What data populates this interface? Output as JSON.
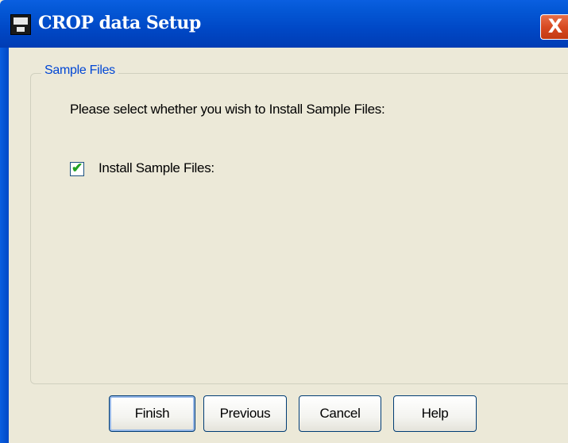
{
  "window": {
    "title": "CROP data Setup",
    "title_icon": "floppy-disk-icon",
    "close_glyph": "X",
    "colors": {
      "titlebar": "#0048c6",
      "close": "#d84a22",
      "body": "#ece9d8",
      "group_label": "#0046d5",
      "checkmark": "#21a121"
    }
  },
  "group": {
    "label": "Sample Files",
    "prompt": "Please select whether you wish to Install Sample Files:",
    "checkbox": {
      "label": "Install Sample Files:",
      "checked": true,
      "glyph": "✔"
    }
  },
  "buttons": {
    "finish": "Finish",
    "previous": "Previous",
    "cancel": "Cancel",
    "help": "Help"
  }
}
